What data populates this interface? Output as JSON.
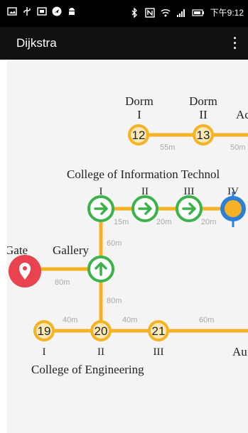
{
  "status_bar": {
    "time": "下午9:12",
    "left_icons": [
      "image-icon",
      "usb-icon",
      "screenshot-icon",
      "navigation-icon",
      "android-icon"
    ],
    "right_icons": [
      "bluetooth-icon",
      "nfc-icon",
      "wifi-icon",
      "signal-icon",
      "battery-icon"
    ]
  },
  "app_bar": {
    "title": "Dijkstra",
    "menu_icon": "more-vert-icon"
  },
  "map": {
    "line_color": "#f5b324",
    "node_fill": "#f5b324",
    "arrow_color": "#3bb34a",
    "gate_color": "#e8434f",
    "highlight_color": "#2c7fd6",
    "edges": {
      "e12_13": "55m",
      "e13_next": "50m",
      "a1_a2": "15m",
      "a2_a3": "20m",
      "a3_a4": "20m",
      "a1_gallery": "60m",
      "gate_gallery": "80m",
      "gallery_20": "80m",
      "e19_20": "40m",
      "e20_21": "40m",
      "e21_next": "60m"
    },
    "nodes": {
      "n12": {
        "number": "12",
        "top": "Dorm",
        "roman": "I"
      },
      "n13": {
        "number": "13",
        "top": "Dorm",
        "roman": "II"
      },
      "n19": {
        "number": "19",
        "roman": "I"
      },
      "n20": {
        "number": "20",
        "roman": "II"
      },
      "n21": {
        "number": "21",
        "roman": "III"
      }
    },
    "labels": {
      "edge_top_right": "Ac",
      "college_info": "College of Information Technol",
      "info_roman": [
        "I",
        "II",
        "III",
        "IV"
      ],
      "gate": "Gate",
      "gallery": "Gallery",
      "college_eng": "College of Engineering",
      "edge_bottom_right": "Au"
    }
  }
}
